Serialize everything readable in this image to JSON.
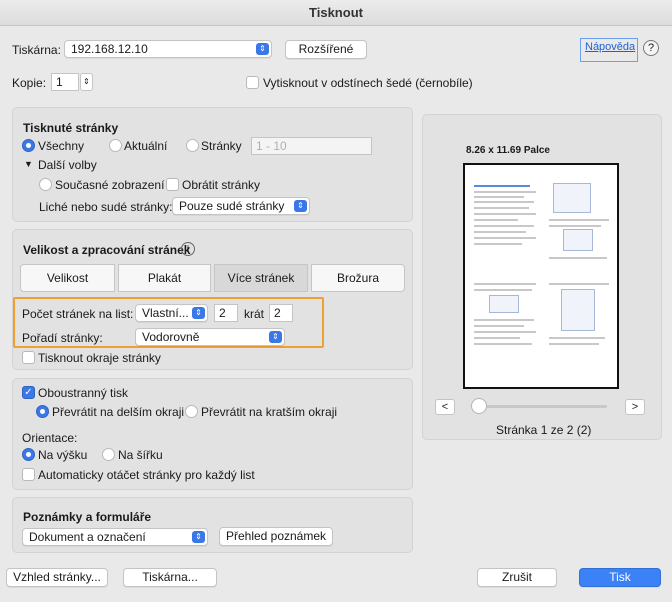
{
  "window": {
    "title": "Tisknout"
  },
  "printer": {
    "label": "Tiskárna:",
    "value": "192.168.12.10",
    "advanced_button": "Rozšířené",
    "help_link": "Nápověda",
    "help_icon": "question-mark-icon"
  },
  "copies": {
    "label": "Kopie:",
    "value": "1",
    "grayscale_label": "Vytisknout v odstínech šedé (černobíle)",
    "grayscale_checked": false
  },
  "pages_section": {
    "title": "Tisknuté stránky",
    "all_label": "Všechny",
    "current_label": "Aktuální",
    "pages_label": "Stránky",
    "pages_placeholder": "1 - 10",
    "more_options_label": "Další volby",
    "current_view_label": "Současné zobrazení",
    "reverse_label": "Obrátit stránky",
    "odd_even_label": "Liché nebo sudé stránky:",
    "odd_even_value": "Pouze sudé stránky"
  },
  "sizing_section": {
    "title": "Velikost a zpracování stránek",
    "info_icon": "info-icon",
    "tabs": [
      "Velikost",
      "Plakát",
      "Více stránek",
      "Brožura"
    ],
    "active_tab": "Více stránek",
    "pages_per_sheet_label": "Počet stránek na list:",
    "pages_per_sheet_value": "Vlastní...",
    "cols_value": "2",
    "times_label": "krát",
    "rows_value": "2",
    "order_label": "Pořadí stránky:",
    "order_value": "Vodorovně",
    "borders_label": "Tisknout okraje stránky",
    "highlight_color": "#f0a030"
  },
  "duplex_section": {
    "duplex_label": "Oboustranný tisk",
    "flip_long_label": "Převrátit na delším okraji",
    "flip_short_label": "Převrátit na kratším okraji",
    "orientation_label": "Orientace:",
    "portrait_label": "Na výšku",
    "landscape_label": "Na šířku",
    "autorotate_label": "Automaticky otáčet stránky pro každý list"
  },
  "notes_section": {
    "title": "Poznámky a formuláře",
    "value": "Dokument a označení",
    "summary_button": "Přehled poznámek"
  },
  "preview": {
    "size_label": "8.26 x 11.69 Palce",
    "page_status": "Stránka 1 ze 2 (2)",
    "prev": "<",
    "next": ">"
  },
  "footer": {
    "page_setup_button": "Vzhled stránky...",
    "printer_button": "Tiskárna...",
    "cancel_button": "Zrušit",
    "print_button": "Tisk",
    "accent_color": "#3b82f6"
  }
}
